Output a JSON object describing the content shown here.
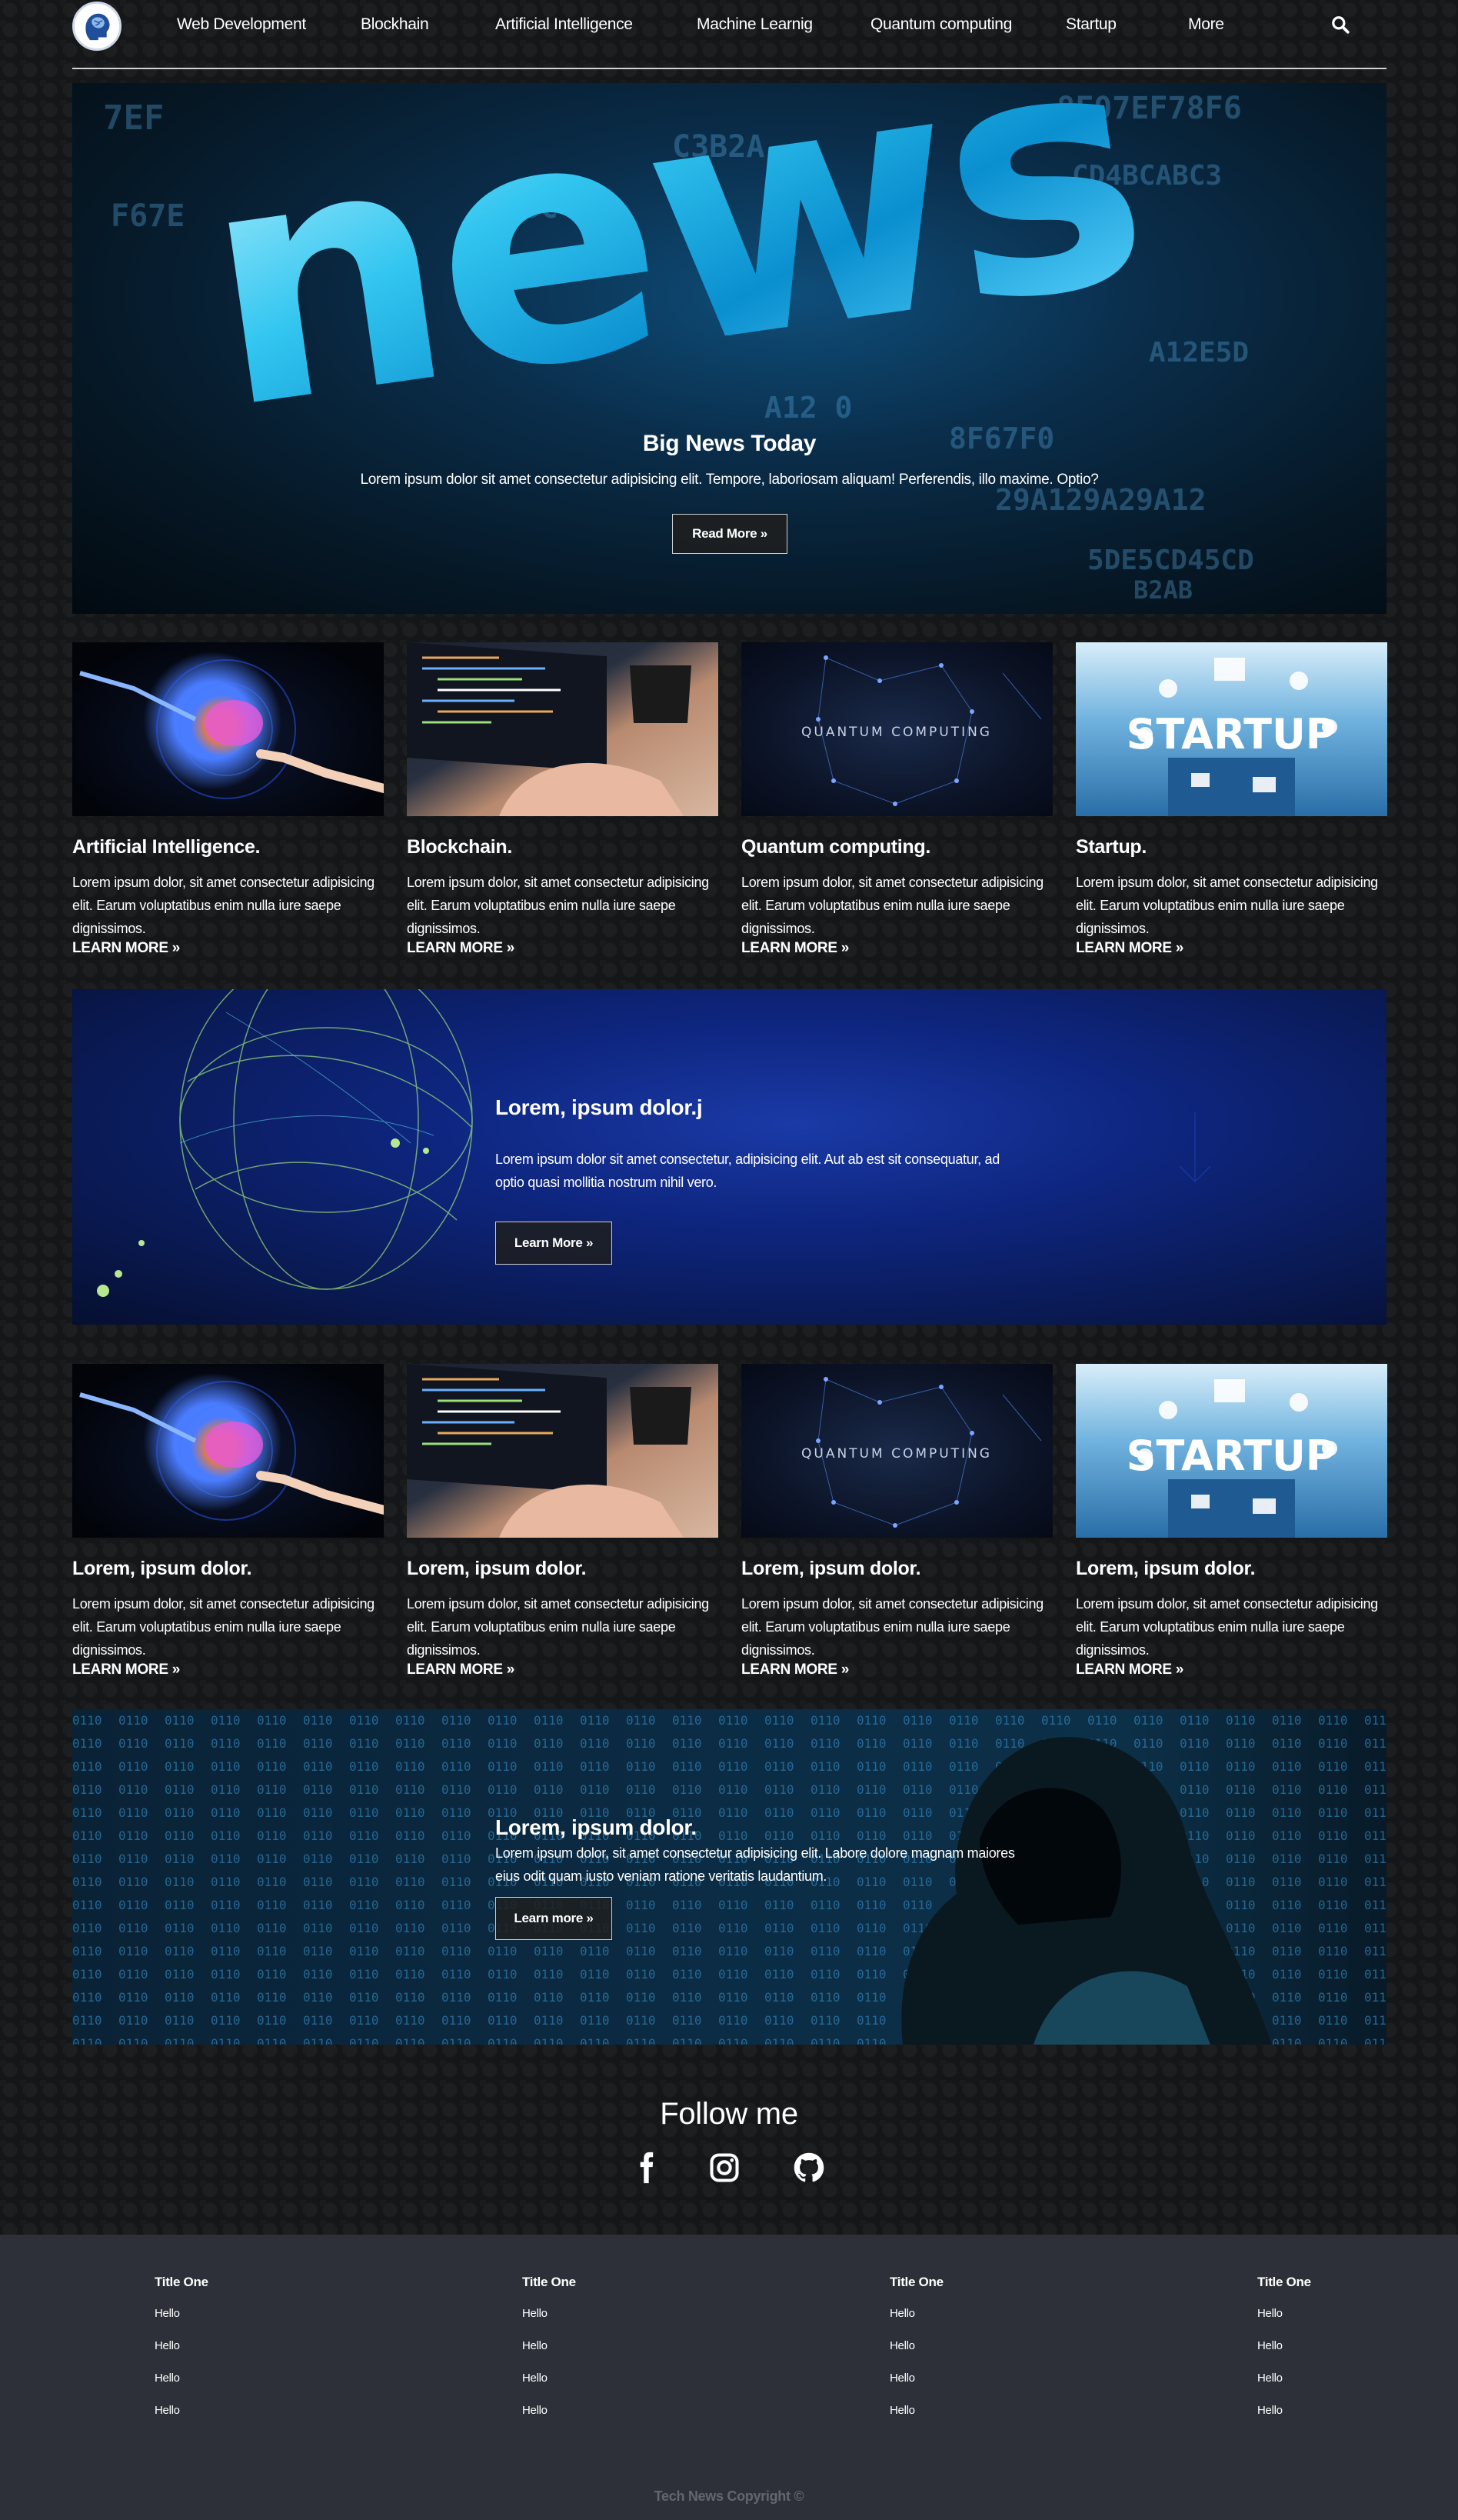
{
  "nav": {
    "items": [
      "Web Development",
      "Blockhain",
      "Artificial Intelligence",
      "Machine Learnig",
      "Quantum computing",
      "Startup",
      "More"
    ]
  },
  "hero": {
    "image_word": "news",
    "title": "Big News Today",
    "text": "Lorem ipsum dolor sit amet consectetur adipisicing elit. Tempore, laboriosam aliquam! Perferendis, illo maxime. Optio?",
    "button": "Read More »"
  },
  "cards_top": [
    {
      "image": "ai-hand-brain",
      "title": "Artificial Intelligence.",
      "text": "Lorem ipsum dolor, sit amet consectetur adipisicing elit. Earum voluptatibus enim nulla iure saepe dignissimos.",
      "link": "LEARN MORE »"
    },
    {
      "image": "laptop-code",
      "title": "Blockchain.",
      "text": "Lorem ipsum dolor, sit amet consectetur adipisicing elit. Earum voluptatibus enim nulla iure saepe dignissimos.",
      "link": "LEARN MORE »"
    },
    {
      "image": "quantum-network",
      "image_caption": "QUANTUM COMPUTING",
      "title": "Quantum computing.",
      "text": "Lorem ipsum dolor, sit amet consectetur adipisicing elit. Earum voluptatibus enim nulla iure saepe dignissimos.",
      "link": "LEARN MORE »"
    },
    {
      "image": "startup-icons",
      "image_caption": "STARTUP",
      "title": "Startup.",
      "text": "Lorem ipsum dolor, sit amet consectetur adipisicing elit. Earum voluptatibus enim nulla iure saepe dignissimos.",
      "link": "LEARN MORE »"
    }
  ],
  "banner1": {
    "title": "Lorem, ipsum dolor.j",
    "text": "Lorem ipsum dolor sit amet consectetur, adipisicing elit. Aut ab est sit consequatur, ad optio quasi mollitia nostrum nihil vero.",
    "button": "Learn More »"
  },
  "cards_bottom": [
    {
      "image": "ai-hand-brain",
      "title": "Lorem, ipsum dolor.",
      "text": "Lorem ipsum dolor, sit amet consectetur adipisicing elit. Earum voluptatibus enim nulla iure saepe dignissimos.",
      "link": "LEARN MORE »"
    },
    {
      "image": "laptop-code",
      "title": "Lorem, ipsum dolor.",
      "text": "Lorem ipsum dolor, sit amet consectetur adipisicing elit. Earum voluptatibus enim nulla iure saepe dignissimos.",
      "link": "LEARN MORE »"
    },
    {
      "image": "quantum-network",
      "image_caption": "QUANTUM COMPUTING",
      "title": "Lorem, ipsum dolor.",
      "text": "Lorem ipsum dolor, sit amet consectetur adipisicing elit. Earum voluptatibus enim nulla iure saepe dignissimos.",
      "link": "LEARN MORE »"
    },
    {
      "image": "startup-icons",
      "image_caption": "STARTUP",
      "title": "Lorem, ipsum dolor.",
      "text": "Lorem ipsum dolor, sit amet consectetur adipisicing elit. Earum voluptatibus enim nulla iure saepe dignissimos.",
      "link": "LEARN MORE »"
    }
  ],
  "banner2": {
    "title": "Lorem, ipsum dolor.",
    "text": "Lorem ipsum dolor, sit amet consectetur adipisicing elit. Labore dolore magnam maiores eius odit quam iusto veniam ratione veritatis laudantium.",
    "button": "Learn more »"
  },
  "follow": {
    "title": "Follow me",
    "icons": [
      "facebook-icon",
      "instagram-icon",
      "github-icon"
    ]
  },
  "footer": {
    "columns": [
      {
        "title": "Title One",
        "links": [
          "Hello",
          "Hello",
          "Hello",
          "Hello"
        ]
      },
      {
        "title": "Title One",
        "links": [
          "Hello",
          "Hello",
          "Hello",
          "Hello"
        ]
      },
      {
        "title": "Title One",
        "links": [
          "Hello",
          "Hello",
          "Hello",
          "Hello"
        ]
      },
      {
        "title": "Title One",
        "links": [
          "Hello",
          "Hello",
          "Hello",
          "Hello"
        ]
      }
    ],
    "copyright": "Tech News Copyright ©"
  },
  "colors": {
    "background": "#141617",
    "footer_bg": "#2d3039",
    "accent_blue": "#33c6f0",
    "text": "#ffffff",
    "copyright": "#62666f"
  }
}
